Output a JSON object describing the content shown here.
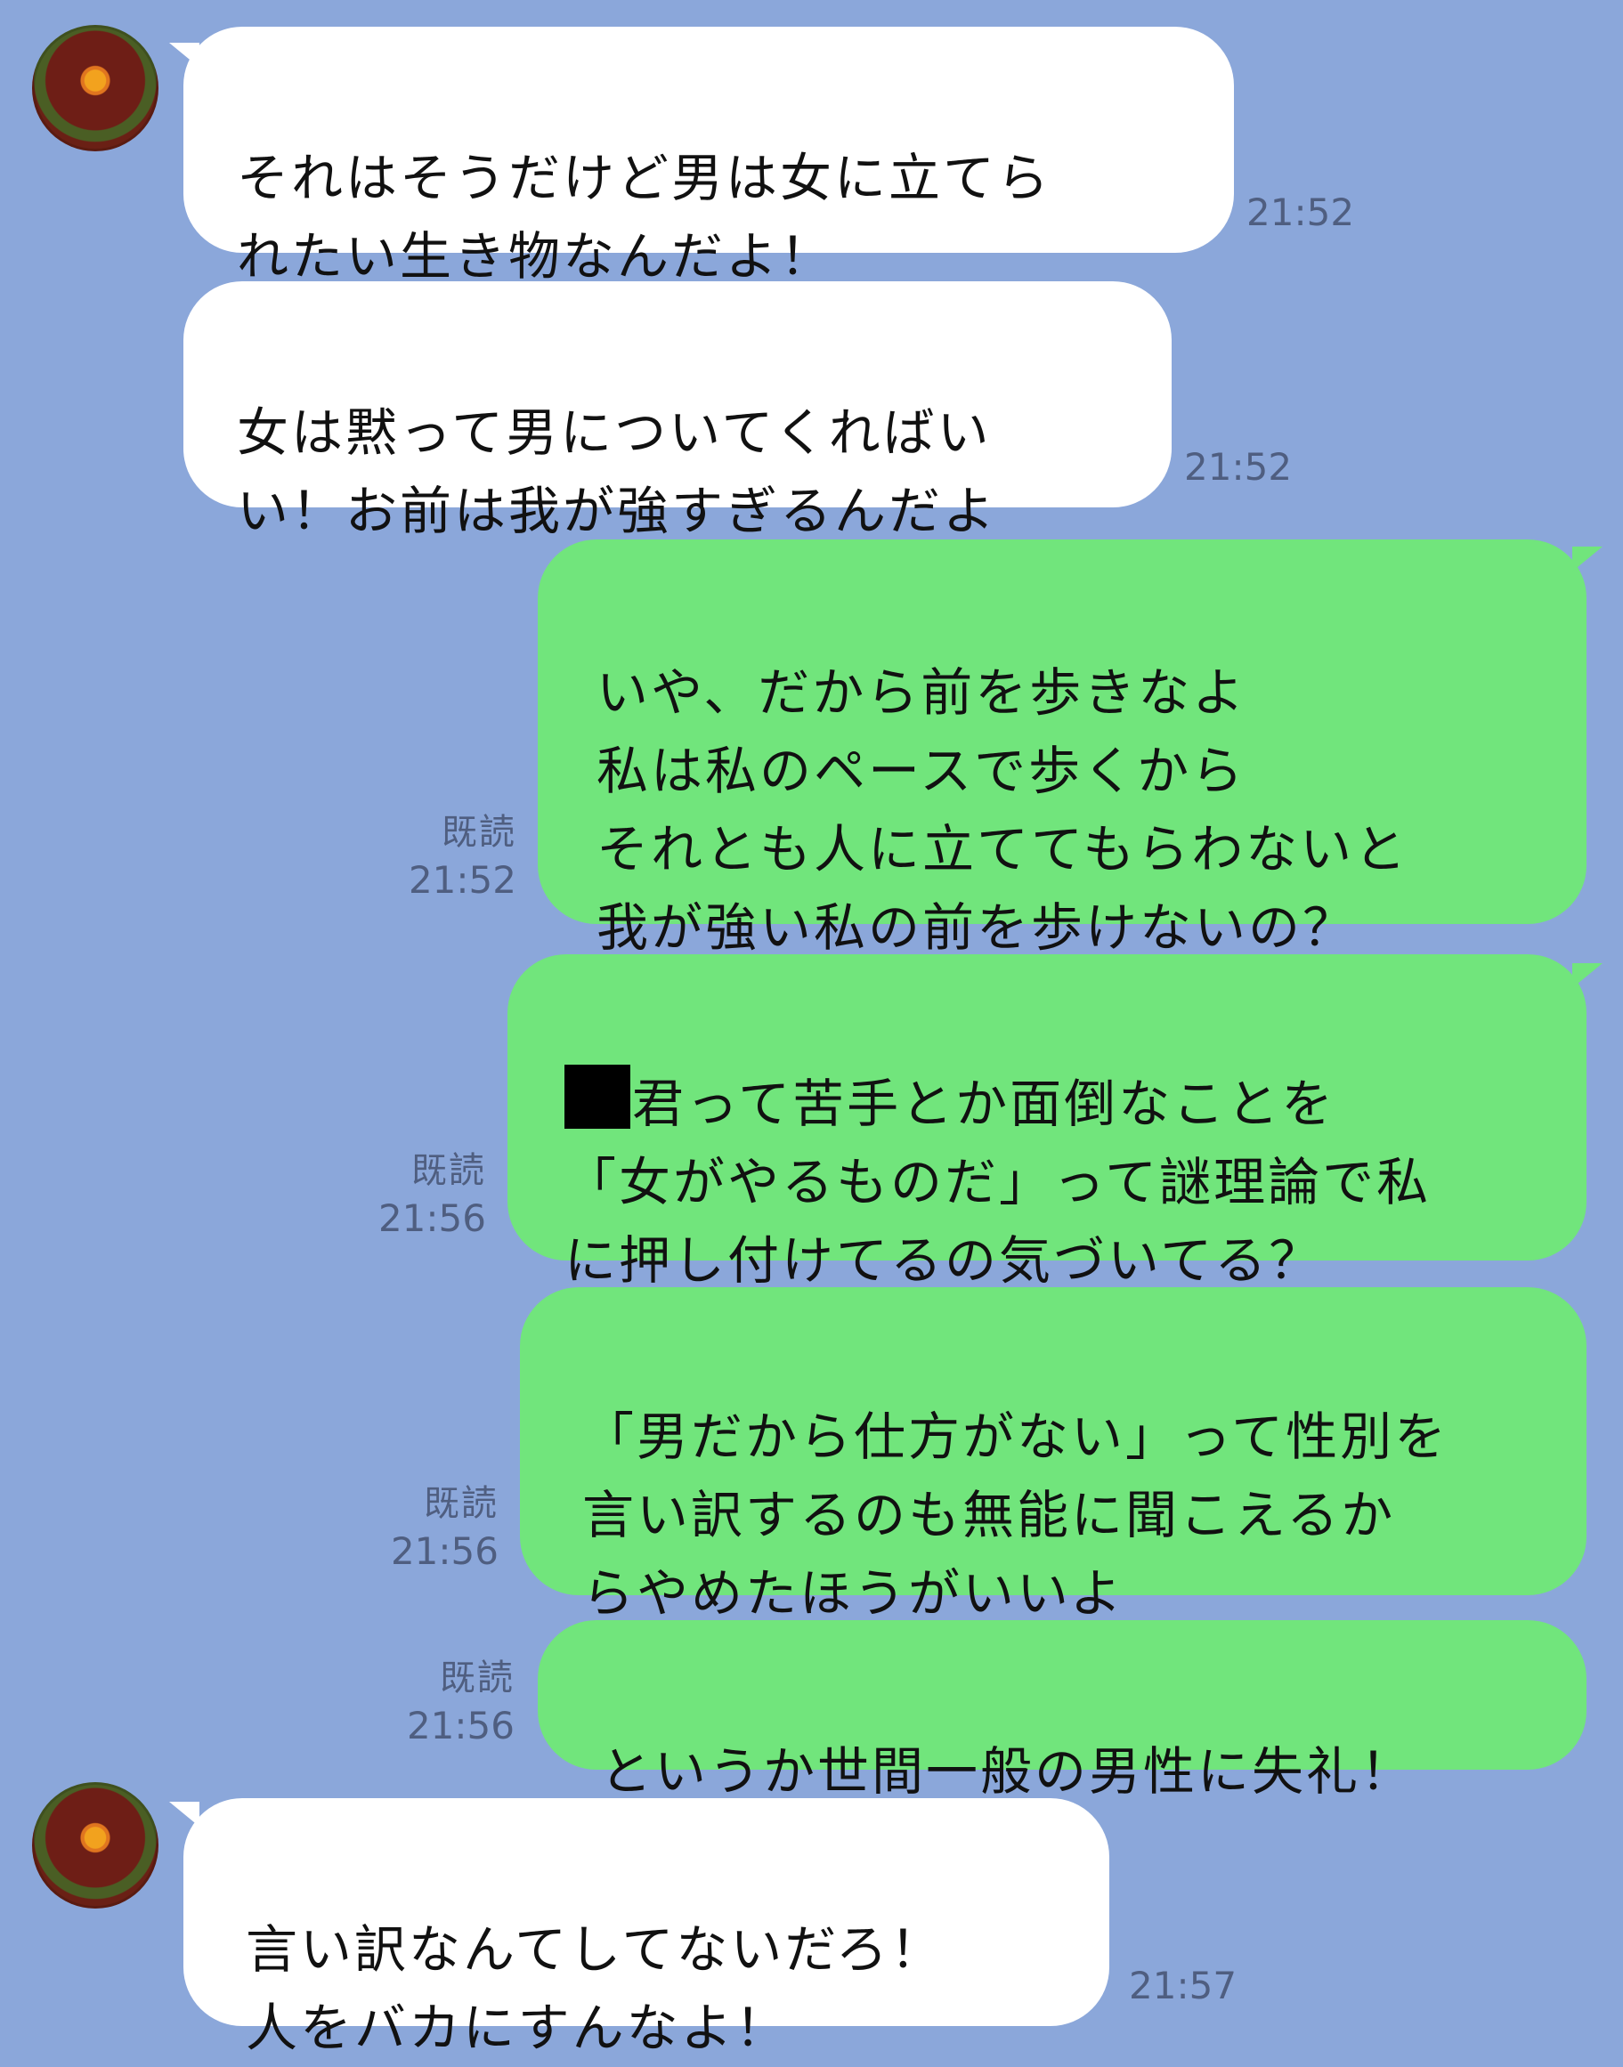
{
  "chat": {
    "messages": [
      {
        "sender": "other",
        "text": "それはそうだけど男は女に立てら\nれたい生き物なんだよ！",
        "time": "21:52"
      },
      {
        "sender": "other",
        "text": "女は黙って男についてくればい\nい！お前は我が強すぎるんだよ",
        "time": "21:52"
      },
      {
        "sender": "me",
        "text": "いや、だから前を歩きなよ\n私は私のペースで歩くから\nそれとも人に立ててもらわないと\n我が強い私の前を歩けないの？",
        "read": "既読",
        "time": "21:52"
      },
      {
        "sender": "me",
        "text": "君って苦手とか面倒なことを\n「女がやるものだ」って謎理論で私\nに押し付けてるの気づいてる？",
        "read": "既読",
        "time": "21:56"
      },
      {
        "sender": "me",
        "text": "「男だから仕方がない」って性別を\n言い訳するのも無能に聞こえるか\nらやめたほうがいいよ",
        "read": "既読",
        "time": "21:56"
      },
      {
        "sender": "me",
        "text": "というか世間一般の男性に失礼！",
        "read": "既読",
        "time": "21:56"
      },
      {
        "sender": "other",
        "text": "言い訳なんてしてないだろ！\n人をバカにすんなよ！",
        "time": "21:57"
      }
    ]
  },
  "colors": {
    "background": "#8BA7DA",
    "incoming_bubble": "#FFFFFF",
    "outgoing_bubble": "#71E57C",
    "meta_text": "#4F5E80"
  },
  "icons": {
    "avatar": "user-avatar-food-photo",
    "redaction": "redacted-name-block"
  }
}
